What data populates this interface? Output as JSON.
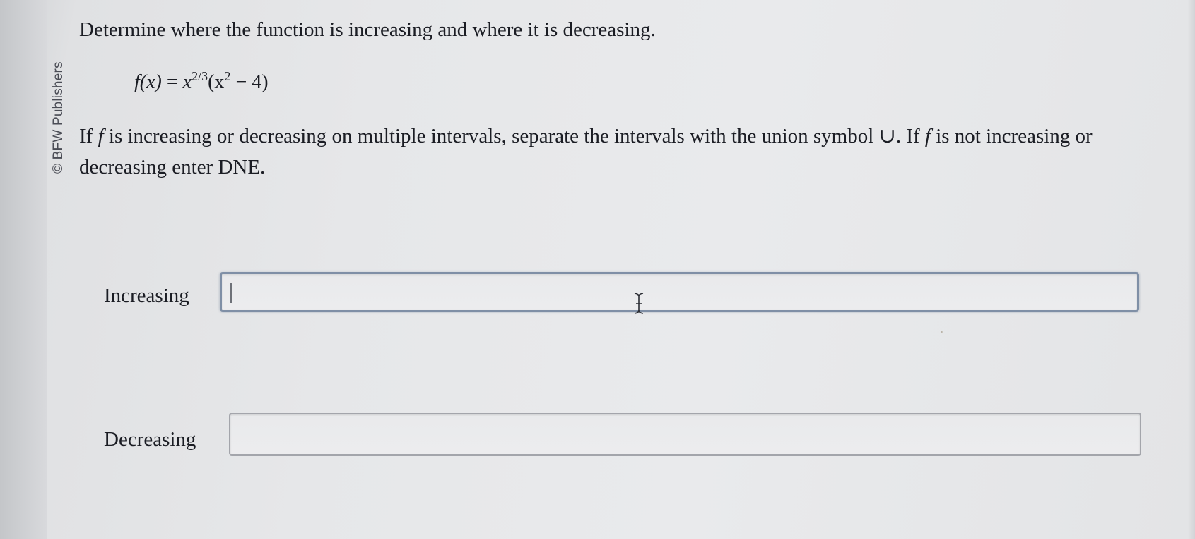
{
  "sidebar": {
    "copyright": "© BFW Publishers"
  },
  "question": {
    "title": "Determine where the function is increasing and where it is decreasing.",
    "formula": {
      "lhs": "f(x)",
      "equals": "=",
      "base": "x",
      "exponent": "2/3",
      "paren_open": "(x",
      "inner_exponent": "2",
      "paren_rest": " − 4)"
    },
    "instructions": {
      "part1": "If ",
      "f1": "f",
      "part2": " is increasing or decreasing on multiple intervals, separate the intervals with the union symbol ∪. If ",
      "f2": "f",
      "part3": " is not increasing or decreasing enter DNE."
    }
  },
  "answers": {
    "increasing": {
      "label": "Increasing",
      "value": ""
    },
    "decreasing": {
      "label": "Decreasing",
      "value": ""
    }
  },
  "colors": {
    "background": "#e7e8ea",
    "text": "#1b1d24",
    "focus_border": "#7f8fa6",
    "box_border": "#a3a5ab"
  },
  "icons": {
    "cursor": "text-cursor-icon"
  }
}
